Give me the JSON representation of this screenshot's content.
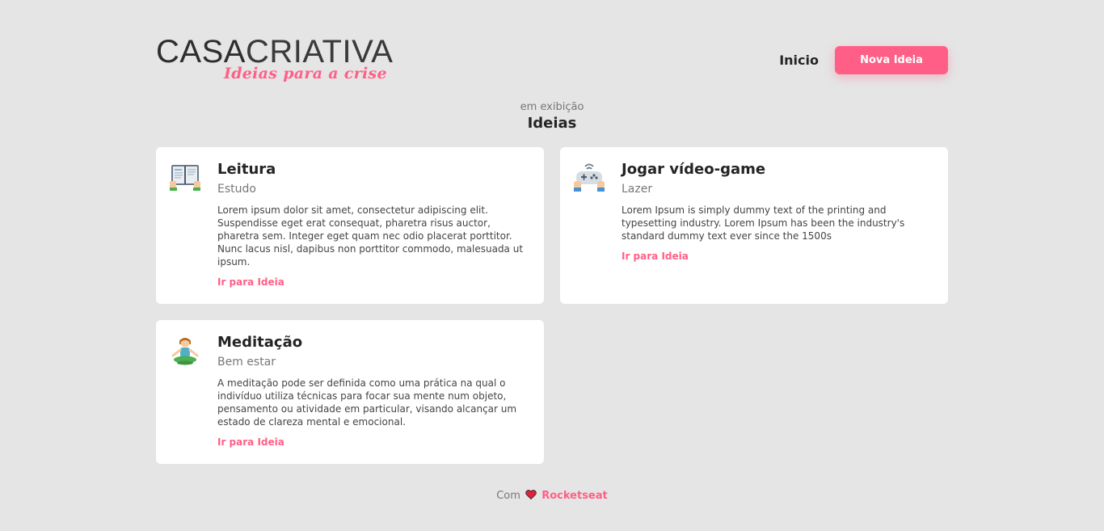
{
  "brand": {
    "main_a": "CASA",
    "main_b": "CRIATIVA",
    "tagline": "Ideias para a crise"
  },
  "nav": {
    "home_label": "Inicio",
    "new_idea_label": "Nova Ideia"
  },
  "section": {
    "subtitle": "em exibição",
    "title": "Ideias"
  },
  "cards": [
    {
      "icon": "reading-book-icon",
      "title": "Leitura",
      "category": "Estudo",
      "text": "Lorem ipsum dolor sit amet, consectetur adipiscing elit. Suspendisse eget erat consequat, pharetra risus auctor, pharetra sem. Integer eget quam nec odio placerat porttitor. Nunc lacus nisl, dapibus non porttitor commodo, malesuada ut ipsum.",
      "link": "Ir para Ideia"
    },
    {
      "icon": "game-controller-icon",
      "title": "Jogar vídeo-game",
      "category": "Lazer",
      "text": "Lorem Ipsum is simply dummy text of the printing and typesetting industry. Lorem Ipsum has been the industry's standard dummy text ever since the 1500s",
      "link": "Ir para Ideia"
    },
    {
      "icon": "meditation-icon",
      "title": "Meditação",
      "category": "Bem estar",
      "text": "A meditação pode ser definida como uma prática na qual o indivíduo utiliza técnicas para focar sua mente num objeto, pensamento ou atividade em particular, visando alcançar um estado de clareza mental e emocional.",
      "link": "Ir para Ideia"
    }
  ],
  "footer": {
    "prefix": "Com",
    "icon": "heart-icon",
    "brand": "Rocketseat"
  },
  "colors": {
    "accent": "#ff5f87",
    "background": "#e5e5e5",
    "card": "#ffffff",
    "text": "#242424"
  }
}
